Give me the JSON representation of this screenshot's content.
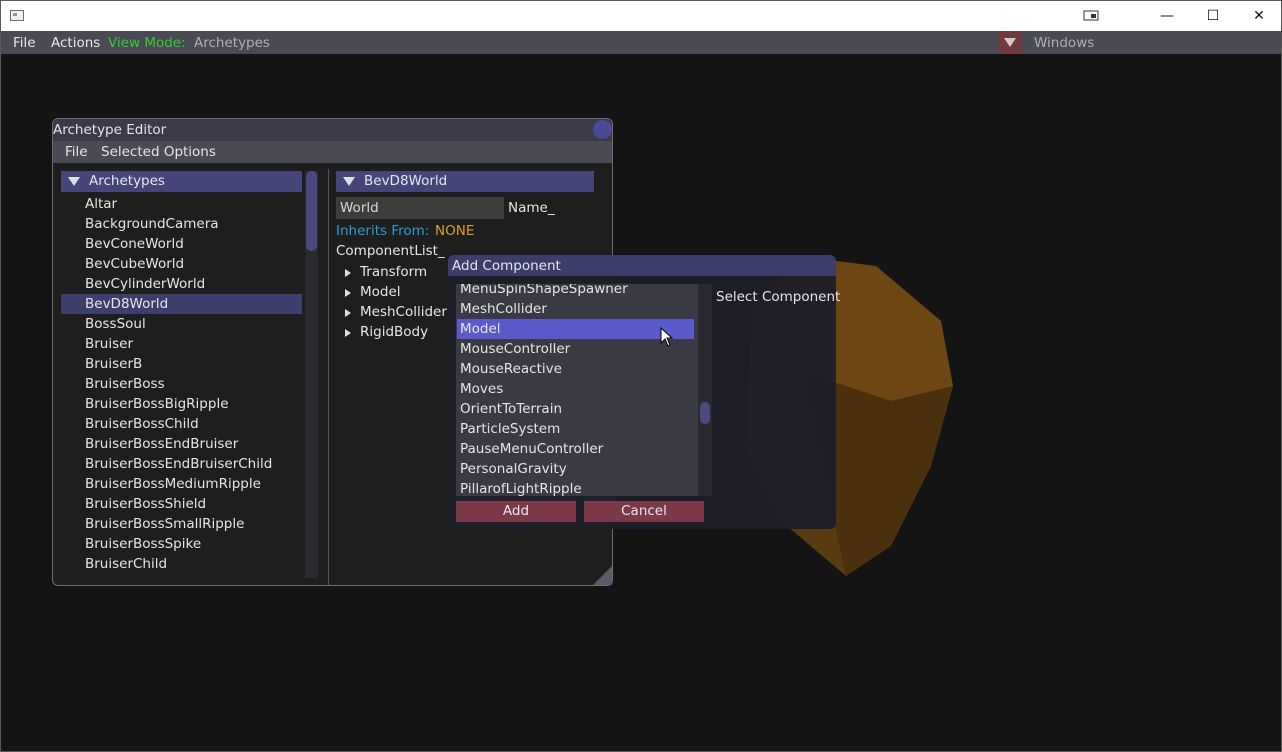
{
  "titlebar": {
    "minimize_glyph": "—",
    "maximize_glyph": "☐",
    "close_glyph": "✕",
    "extra_icon": "display-icon"
  },
  "menubar": {
    "file": "File",
    "actions": "Actions",
    "view_mode_label": "View Mode:",
    "view_mode_value": "Archetypes",
    "windows": "Windows"
  },
  "editor": {
    "title": "Archetype Editor",
    "menu": [
      "File",
      "Selected Options"
    ],
    "archetypes_header": "Archetypes",
    "archetypes": [
      "Altar",
      "BackgroundCamera",
      "BevConeWorld",
      "BevCubeWorld",
      "BevCylinderWorld",
      "BevD8World",
      "BossSoul",
      "Bruiser",
      "BruiserB",
      "BruiserBoss",
      "BruiserBossBigRipple",
      "BruiserBossChild",
      "BruiserBossEndBruiser",
      "BruiserBossEndBruiserChild",
      "BruiserBossMediumRipple",
      "BruiserBossShield",
      "BruiserBossSmallRipple",
      "BruiserBossSpike",
      "BruiserChild"
    ],
    "selected_archetype": "BevD8World",
    "detail": {
      "header": "BevD8World",
      "name_value": "World",
      "name_label": "Name_",
      "inherits_label": "Inherits From:",
      "inherits_value": "NONE",
      "component_list_label": "ComponentList_",
      "components": [
        "Transform",
        "Model",
        "MeshCollider",
        "RigidBody"
      ]
    }
  },
  "add_component": {
    "title": "Add Component",
    "hint": "Select Component",
    "items": [
      "MenuSpinShapeSpawner",
      "MeshCollider",
      "Model",
      "MouseController",
      "MouseReactive",
      "Moves",
      "OrientToTerrain",
      "ParticleSystem",
      "PauseMenuController",
      "PersonalGravity",
      "PillarofLightRipple"
    ],
    "selected": "Model",
    "add_label": "Add",
    "cancel_label": "Cancel"
  },
  "colors": {
    "accent_header": "#45457a",
    "selection": "#5a5acc",
    "button": "#7a3a48",
    "inherits_label": "#2a9fd6",
    "inherits_value": "#d6a02a",
    "view_mode": "#33cc33"
  }
}
